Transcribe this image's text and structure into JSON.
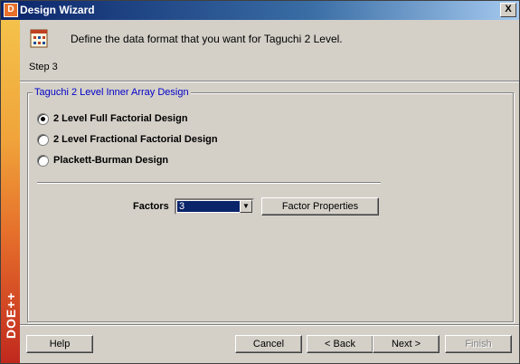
{
  "window": {
    "title": "Design Wizard",
    "app_icon": "D",
    "close_label": "X",
    "brand": "DOE++"
  },
  "header": {
    "instruction": "Define the data format that you want for Taguchi 2 Level.",
    "step": "Step 3",
    "icon": "wizard-step-icon"
  },
  "group": {
    "title": "Taguchi 2 Level Inner Array Design",
    "options": [
      {
        "label": "2 Level Full Factorial Design",
        "checked": true
      },
      {
        "label": "2 Level Fractional Factorial Design",
        "checked": false
      },
      {
        "label": "Plackett-Burman Design",
        "checked": false
      }
    ]
  },
  "factors": {
    "label": "Factors",
    "value": "3",
    "properties_button": "Factor Properties"
  },
  "buttons": {
    "help": "Help",
    "cancel": "Cancel",
    "back": "< Back",
    "next": "Next >",
    "finish": "Finish"
  },
  "colors": {
    "title_bar": "#0a246a",
    "group_title": "#0000c8",
    "selection": "#0a246a"
  }
}
